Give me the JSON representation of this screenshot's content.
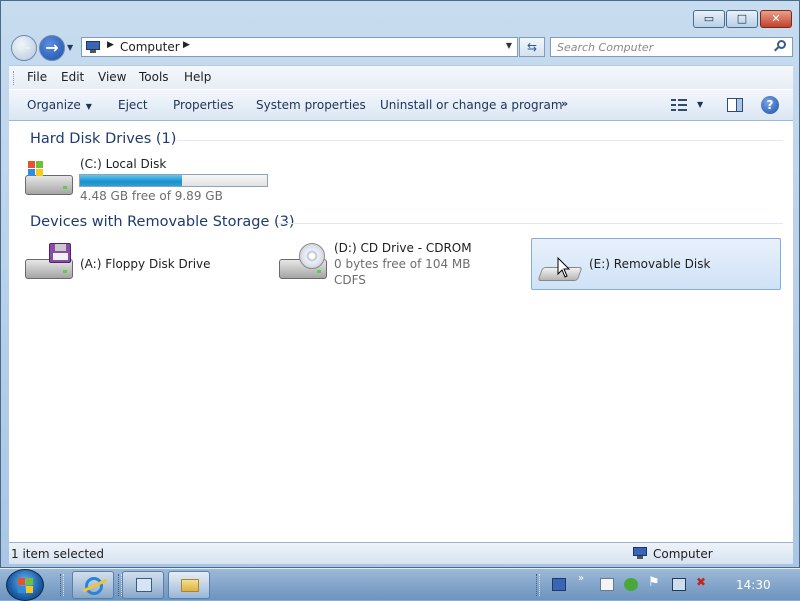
{
  "window": {
    "minimize_glyph": "▭",
    "maximize_glyph": "□",
    "close_glyph": "✕"
  },
  "address": {
    "location": "Computer",
    "search_placeholder": "Search Computer"
  },
  "menubar": {
    "file": "File",
    "edit": "Edit",
    "view": "View",
    "tools": "Tools",
    "help": "Help"
  },
  "commandbar": {
    "organize": "Organize",
    "eject": "Eject",
    "properties": "Properties",
    "system_properties": "System properties",
    "uninstall": "Uninstall or change a program",
    "more": "»"
  },
  "groups": {
    "hard_disk": "Hard Disk Drives (1)",
    "removable": "Devices with Removable Storage (3)"
  },
  "drives": {
    "c": {
      "label": "(C:) Local Disk",
      "free_text": "4.48 GB free of 9.89 GB",
      "used_fraction": 0.547
    },
    "a": {
      "label": "(A:) Floppy Disk Drive"
    },
    "d": {
      "label": "(D:) CD Drive - CDROM",
      "free_text": "0 bytes free of 104 MB",
      "fs": "CDFS"
    },
    "e": {
      "label": "(E:) Removable Disk",
      "selected": true
    }
  },
  "status": {
    "selection": "1 item selected",
    "location": "Computer"
  },
  "taskbar": {
    "clock": "14:30"
  },
  "colors": {
    "accent": "#1e8fca",
    "selection_bg": "#cfe2f7",
    "header_text": "#1e3b6e"
  }
}
